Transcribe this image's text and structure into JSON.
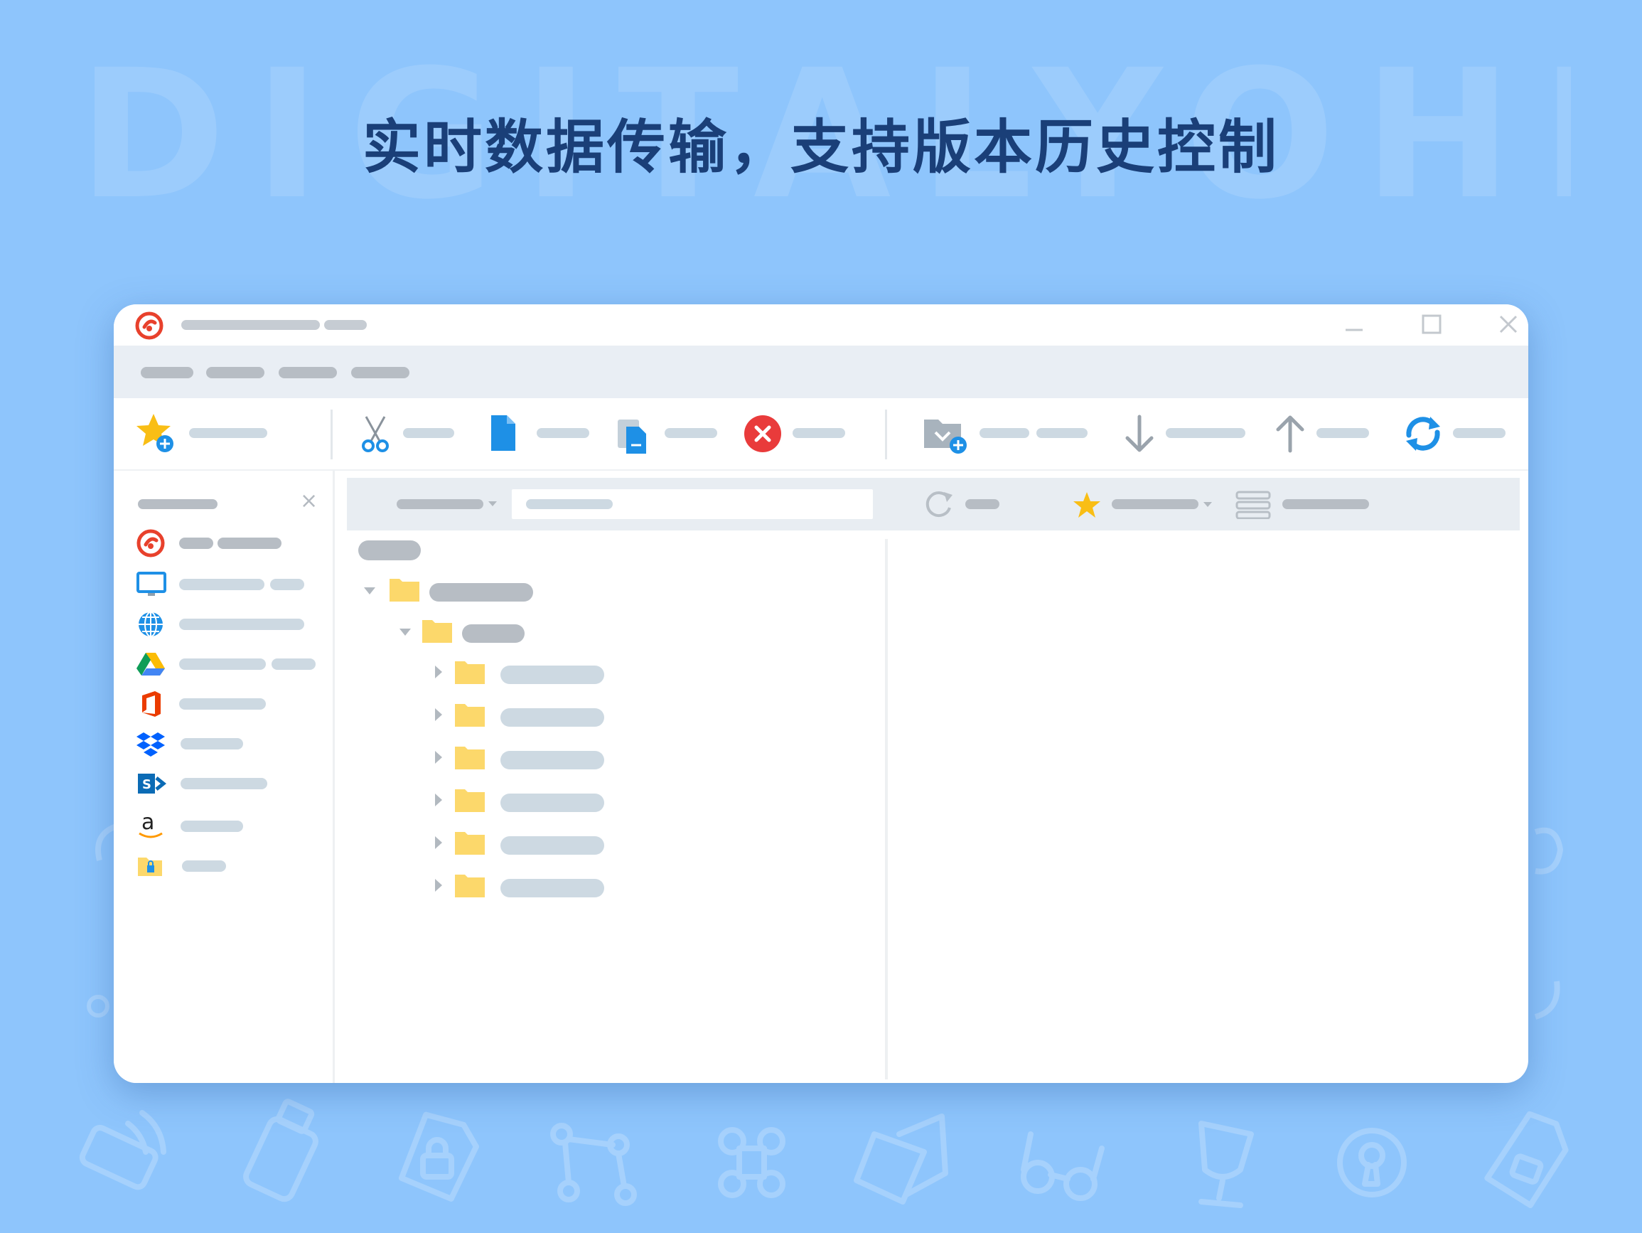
{
  "banner": {
    "watermark": "DIGITALYOHEE",
    "headline": "实时数据传输，支持版本历史控制"
  },
  "app": {
    "brand_color": "#e8412c",
    "accent_color": "#1e90e6",
    "folder_color": "#fcd86b",
    "star_color": "#f9be15",
    "window_controls": [
      "minimize-icon",
      "maximize-icon",
      "close-icon"
    ]
  },
  "toolbar": {
    "buttons": [
      "add-favorite-icon",
      "cut-icon",
      "copy-icon",
      "paste-icon",
      "delete-icon",
      "new-folder-icon",
      "download-icon",
      "upload-icon",
      "sync-icon"
    ]
  },
  "sidebar": {
    "close_glyph": "×",
    "items": [
      "app-logo-icon",
      "computer-icon",
      "globe-icon",
      "google-drive-icon",
      "office-icon",
      "dropbox-icon",
      "sharepoint-icon",
      "amazon-icon",
      "locked-folder-icon"
    ],
    "amazon_letter": "a"
  }
}
